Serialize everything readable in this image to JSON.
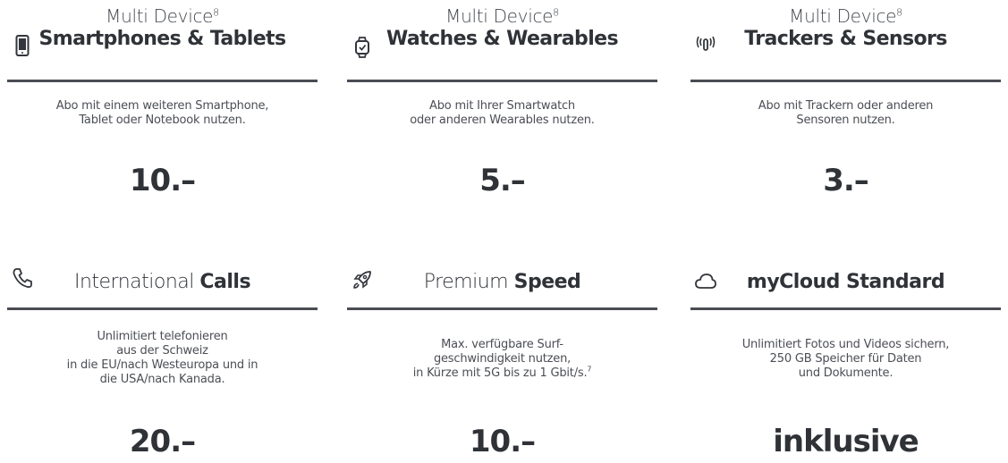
{
  "rows": [
    [
      {
        "pre": "Multi Device",
        "sup": "8",
        "title": "Smartphones & Tablets",
        "icon": "smartphone-icon",
        "desc": "Abo mit einem weiteren Smartphone,\nTablet oder Notebook nutzen.",
        "price": "10.–"
      },
      {
        "pre": "Multi Device",
        "sup": "8",
        "title": "Watches & Wearables",
        "icon": "smartwatch-icon",
        "desc": "Abo mit Ihrer Smartwatch\noder anderen Wearables nutzen.",
        "price": "5.–"
      },
      {
        "pre": "Multi Device",
        "sup": "8",
        "title": "Trackers & Sensors",
        "icon": "antenna-signal-icon",
        "desc": "Abo mit Trackern oder anderen\nSensoren nutzen.",
        "price": "3.–"
      }
    ],
    [
      {
        "title_light": "International",
        "title_bold": "Calls",
        "icon": "phone-icon",
        "desc": "Unlimitiert telefonieren\naus der Schweiz\nin die EU/nach Westeuropa und in\ndie USA/nach Kanada.",
        "price": "20.–"
      },
      {
        "title_light": "Premium",
        "title_bold": "Speed",
        "icon": "rocket-icon",
        "desc": "Max. verfügbare Surf-\ngeschwindigkeit nutzen,\nin Kürze mit 5G bis zu 1 Gbit/s.",
        "desc_sup": "7",
        "price": "10.–"
      },
      {
        "title_light": "",
        "title_bold": "myCloud Standard",
        "icon": "cloud-icon",
        "desc": "Unlimitiert Fotos und Videos sichern,\n250 GB Speicher für Daten\nund Dokumente.",
        "price": "inklusive"
      }
    ]
  ]
}
